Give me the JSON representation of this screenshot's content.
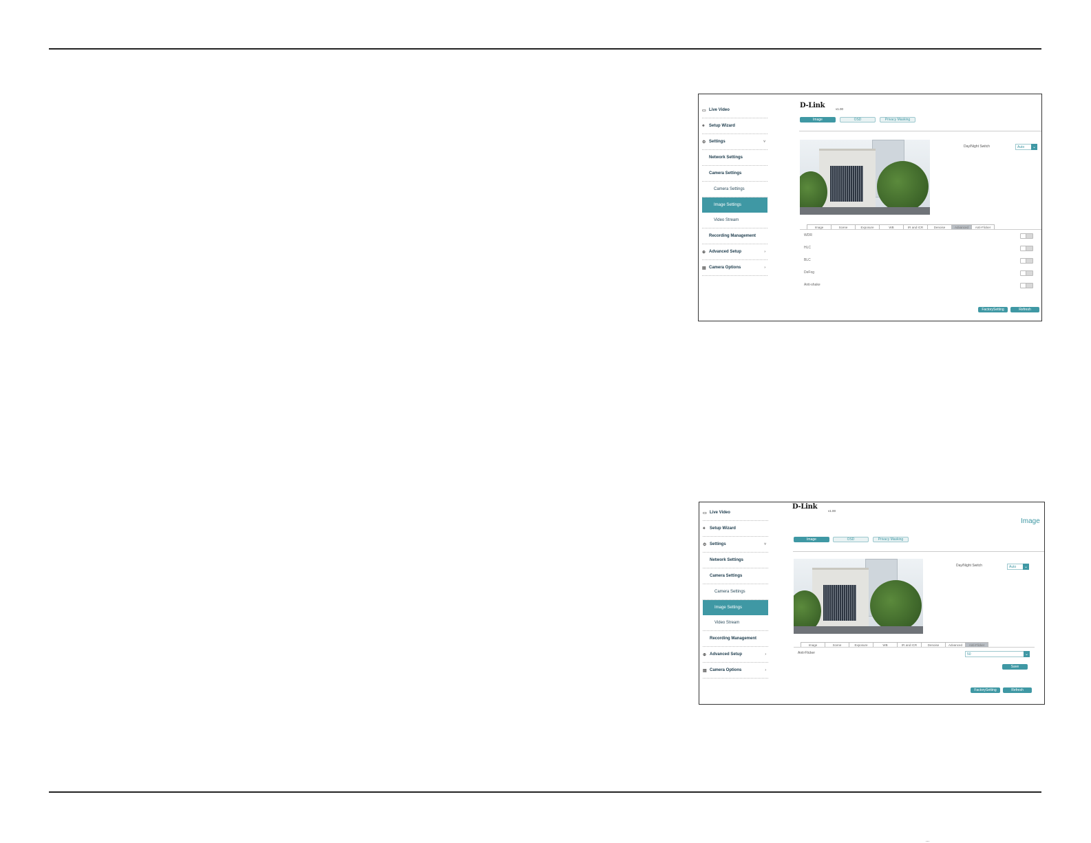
{
  "nav": [
    {
      "label": "Live Video",
      "icon": "camera-icon",
      "level": "top"
    },
    {
      "label": "Setup Wizard",
      "icon": "wand-icon",
      "level": "top"
    },
    {
      "label": "Settings",
      "icon": "gear-icon",
      "level": "top",
      "arrow": "˅"
    },
    {
      "label": "Network Settings",
      "level": "l1"
    },
    {
      "label": "Camera Settings",
      "level": "l1"
    },
    {
      "label": "Camera Settings",
      "level": "l2"
    },
    {
      "label": "Image Settings",
      "level": "l2",
      "active": true
    },
    {
      "label": "Video Stream",
      "level": "l2"
    },
    {
      "label": "Recording Management",
      "level": "l1"
    },
    {
      "label": "Advanced Setup",
      "icon": "advanced-icon",
      "level": "top",
      "arrow": "›"
    },
    {
      "label": "Camera Options",
      "icon": "document-icon",
      "level": "top",
      "arrow": "›"
    }
  ],
  "logo": "D-Link",
  "version": "v1.00",
  "top_tabs": [
    "Image",
    "OSD",
    "Privacy Masking"
  ],
  "day_night": {
    "label": "Day/Night Switch",
    "value": "Auto"
  },
  "sub_tabs": [
    "Image",
    "Scene",
    "Exposure",
    "WB",
    "IR and ICR",
    "Denoise",
    "Advanced",
    "Anti-Flicker"
  ],
  "shot1": {
    "active_sub_tab": "Advanced",
    "toggles": [
      "WDR",
      "HLC",
      "BLC",
      "DeFog",
      "Anti-shake"
    ]
  },
  "shot2": {
    "heading": "Image",
    "active_sub_tab": "Anti-Flicker",
    "anti_flicker": {
      "label": "Anti-Flicker",
      "value": "50"
    },
    "save_label": "Save"
  },
  "buttons": {
    "factory": "FactorySetting",
    "refresh": "Refresh"
  },
  "footer": "...",
  "colors": {
    "accent": "#3f98a4",
    "text": "#1b3a4b"
  }
}
